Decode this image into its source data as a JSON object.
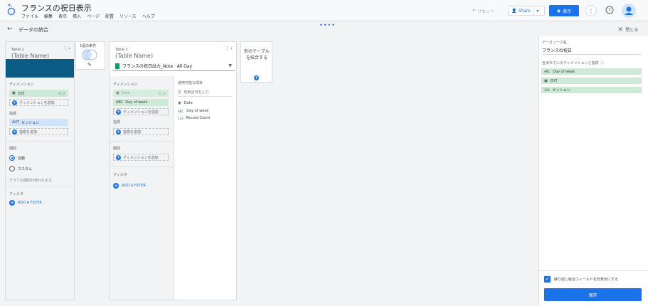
{
  "app": {
    "title": "フランスの祝日表示",
    "menu": [
      "ファイル",
      "編集",
      "表示",
      "挿入",
      "ページ",
      "配置",
      "リソース",
      "ヘルプ"
    ],
    "reset_label": "リセット",
    "share_label": "Share",
    "view_label": "表示",
    "colors": {
      "accent": "#1a73e8",
      "green_chip": "#ceead6",
      "blue_chip": "#d2e3fc",
      "table1_preview": "#0b5c84"
    }
  },
  "subheader": {
    "title": "データの統合",
    "close_label": "閉じる"
  },
  "table1": {
    "label": "Table 1",
    "name": "(Table Name)",
    "dimensions_label": "ディメンション",
    "dimension_chip": "日付",
    "add_dimension": "ディメンションを追加",
    "metrics_label": "指標",
    "metric_chip": "セッション",
    "add_metric": "指標を追加",
    "period_label": "期間",
    "period_auto": "自動",
    "period_custom": "カスタム",
    "period_note": "グラフの期間が使われます。",
    "filter_label": "フィルタ",
    "add_filter": "ADD A FILTER"
  },
  "join": {
    "condition_label": "1個の条件"
  },
  "table2": {
    "label": "Table 2",
    "name": "(Table Name)",
    "datasource": "フランスの祝日出力_Note · All Day",
    "dimensions_label": "ディメンション",
    "dimension_chip_1": "Date",
    "dimension_chip_2": "Day of week",
    "add_dimension": "ディメンションを追加",
    "metrics_label": "指標",
    "add_metric": "指標を追加",
    "period_label": "期間",
    "add_period_dimension": "ディメンションを追加",
    "filter_label": "フィルタ",
    "add_filter": "ADD A FILTER",
    "available_label": "使用可能な項目",
    "search_placeholder": "検索語句を入力",
    "fields": [
      {
        "type": "cal",
        "name": "Date"
      },
      {
        "type": "ABC",
        "name": "Day of week"
      },
      {
        "type": "123",
        "name": "Record Count"
      }
    ]
  },
  "add_table": {
    "label": "別のテーブルを結合する"
  },
  "right_panel": {
    "datasource_label": "データソース名",
    "datasource_name": "フランスの祝日",
    "included_label": "含まれているディメンションと指標",
    "items": [
      {
        "type": "ABC",
        "name": "Day of week"
      },
      {
        "type": "cal",
        "name": "日付"
      },
      {
        "type": "123",
        "name": "セッション"
      }
    ],
    "checkbox_label": "繰り返し結合フィールドを非表示にする",
    "save_label": "保存"
  }
}
